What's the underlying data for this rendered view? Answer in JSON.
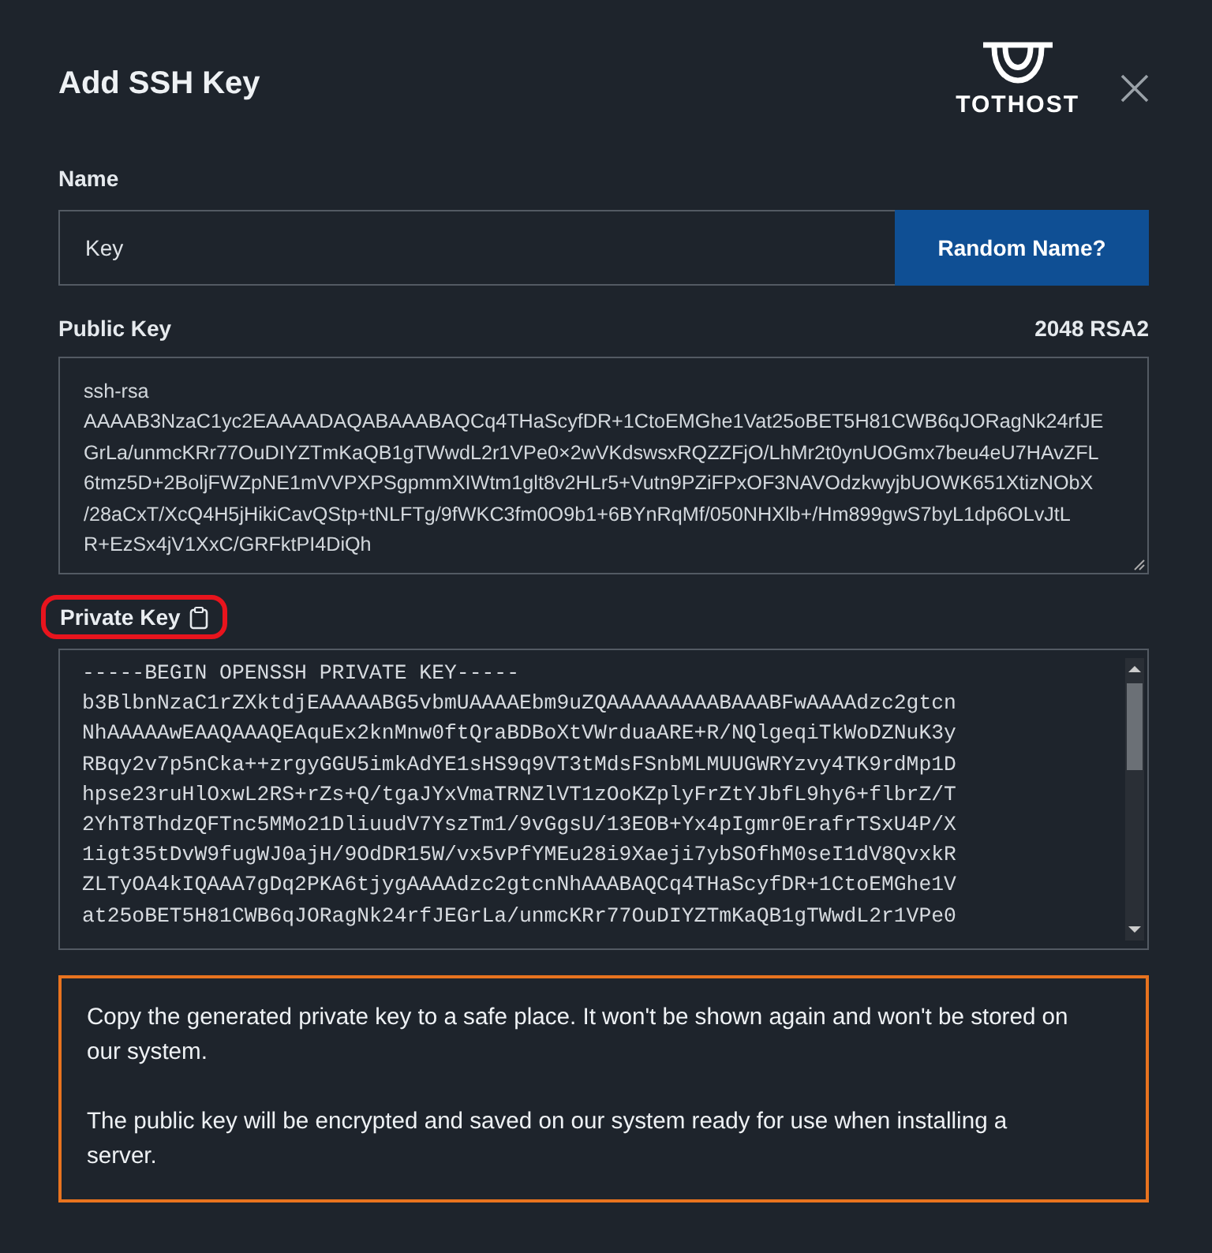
{
  "dialog": {
    "title": "Add SSH Key",
    "logo_text": "TOTHOST"
  },
  "name_field": {
    "label": "Name",
    "value": "Key",
    "button": "Random Name?"
  },
  "public_key": {
    "label": "Public Key",
    "key_type": "2048 RSA2",
    "lines": [
      "ssh-rsa",
      "AAAAB3NzaC1yc2EAAAADAQABAAABAQCq4THaScyfDR+1CtoEMGhe1Vat25oBET5H81CWB6qJORagNk24rfJE",
      "GrLa/unmcKRr77OuDIYZTmKaQB1gTWwdL2r1VPe0×2wVKdswsxRQZZFjO/LhMr2t0ynUOGmx7beu4eU7HAvZFL",
      "6tmz5D+2BoljFWZpNE1mVVPXPSgpmmXIWtm1glt8v2HLr5+Vutn9PZiFPxOF3NAVOdzkwyjbUOWK651XtizNObX",
      "/28aCxT/XcQ4H5jHikiCavQStp+tNLFTg/9fWKC3fm0O9b1+6BYnRqMf/050NHXlb+/Hm899gwS7byL1dp6OLvJtL",
      "R+EzSx4jV1XxC/GRFktPI4DiQh"
    ]
  },
  "private_key": {
    "label": "Private Key",
    "highlighted": true,
    "lines": [
      "-----BEGIN OPENSSH PRIVATE KEY-----",
      "b3BlbnNzaC1rZXktdjEAAAAABG5vbmUAAAAEbm9uZQAAAAAAAAABAAABFwAAAAdzc2gtcn",
      "NhAAAAAwEAAQAAAQEAquEx2knMnw0ftQraBDBoXtVWrduaARE+R/NQlgeqiTkWoDZNuK3y",
      "RBqy2v7p5nCka++zrgyGGU5imkAdYE1sHS9q9VT3tMdsFSnbMLMUUGWRYzvy4TK9rdMp1D",
      "hpse23ruHlOxwL2RS+rZs+Q/tgaJYxVmaTRNZlVT1zOoKZplyFrZtYJbfL9hy6+flbrZ/T",
      "2YhT8ThdzQFTnc5MMo21DliuudV7YszTm1/9vGgsU/13EOB+Yx4pIgmr0ErafrTSxU4P/X",
      "1igt35tDvW9fugWJ0ajH/9OdDR15W/vx5vPfYMEu28i9Xaeji7ybSOfhM0seI1dV8QvxkR",
      "ZLTyOA4kIQAAA7gDq2PKA6tjygAAAAdzc2gtcnNhAAABAQCq4THaScyfDR+1CtoEMGhe1V",
      "at25oBET5H81CWB6qJORagNk24rfJEGrLa/unmcKRr77OuDIYZTmKaQB1gTWwdL2r1VPe0"
    ]
  },
  "notice": {
    "paragraphs": [
      "Copy the generated private key to a safe place. It won't be shown again and won't be stored on our system.",
      "The public key will be encrypted and saved on our system ready for use when installing a server."
    ]
  }
}
